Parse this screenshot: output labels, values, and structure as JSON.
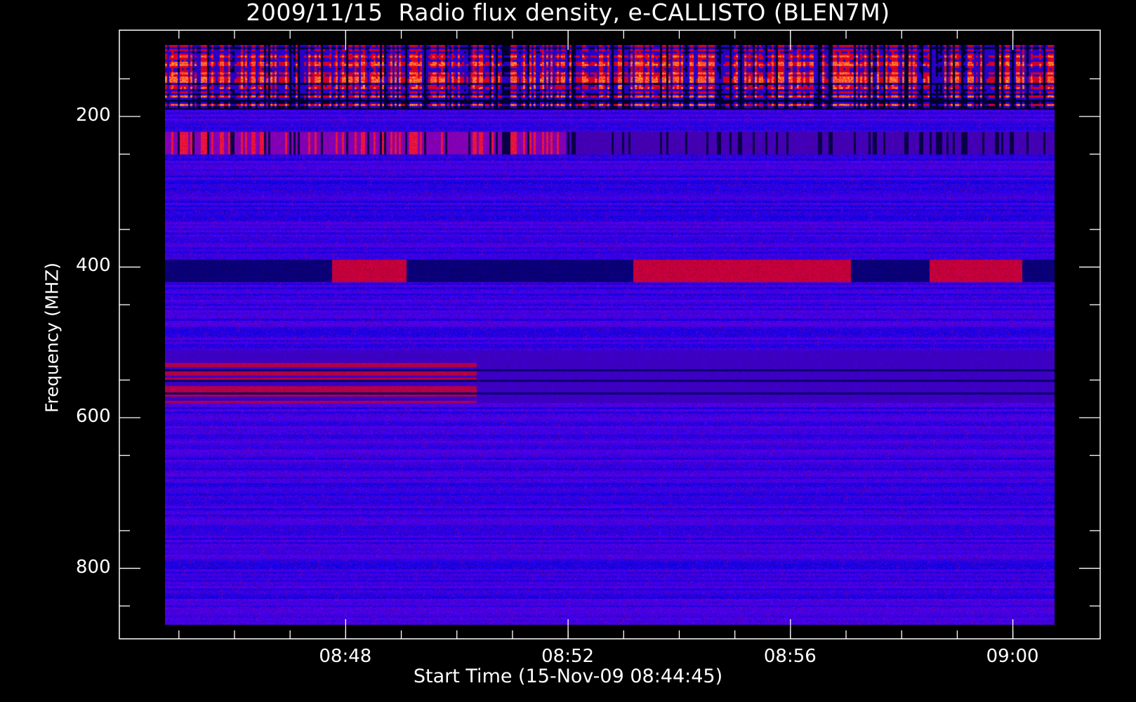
{
  "chart_data": {
    "type": "heatmap",
    "title": "2009/11/15  Radio flux density, e-CALLISTO (BLEN7M)",
    "xlabel": "Start Time (15-Nov-09 08:44:45)",
    "ylabel": "Frequency (MHZ)",
    "x_range": [
      "08:44:45",
      "09:00:45"
    ],
    "y_range": [
      105,
      875
    ],
    "y_axis_inverted": true,
    "x_ticks": [
      "08:48",
      "08:52",
      "08:56",
      "09:00"
    ],
    "y_ticks": [
      200,
      400,
      600,
      800
    ],
    "colormap": [
      "#000000",
      "#0000ff",
      "#ff0000",
      "#ffff00",
      "#ffffff"
    ],
    "background_color": "#000000",
    "enhanced_bands_mhz": [
      [
        105,
        190
      ],
      [
        220,
        250
      ],
      [
        390,
        420
      ],
      [
        510,
        580
      ]
    ],
    "enhanced_intervals_near_400mhz": [
      [
        "08:47:45",
        "08:49:05"
      ],
      [
        "08:53:10",
        "08:57:05"
      ],
      [
        "08:58:30",
        "09:00:10"
      ]
    ]
  }
}
